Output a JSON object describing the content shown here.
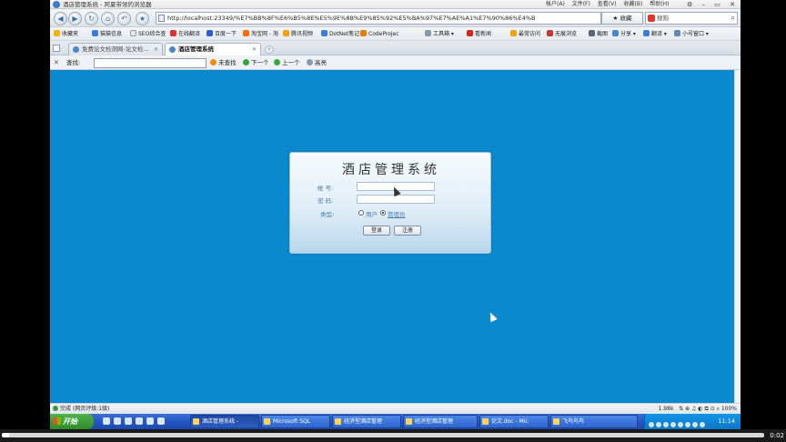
{
  "window": {
    "title": "酒店管理系统 - 阿夏带领的浏览器",
    "menus": [
      "帐户(A)",
      "文件(F)",
      "查看(V)",
      "收藏(B)",
      "帮助(H)"
    ],
    "controls": [
      "⚙",
      "–",
      "▭",
      "✕"
    ]
  },
  "nav": {
    "back_icon": "back-arrow-icon",
    "forward_icon": "forward-arrow-icon",
    "url": "http://localhost:23349/%E7%BB%8F%E6%B5%8E%E5%9E%8B%E9%85%92%E5%BA%97%E7%AE%A1%E7%90%86%E4%B",
    "favorite_label": "★ 收藏",
    "search_placeholder": "搜狗"
  },
  "bookmarks": [
    "收藏夹",
    "猫猫信息",
    "SEO综合查",
    "在线翻译",
    "百度一下",
    "淘宝网 - 淘",
    "腾讯视频",
    "DotNet笔记",
    "CodeProjec",
    "工具箱",
    "看新闻",
    "最常访问",
    "无痕浏览",
    "截图",
    "分享",
    "翻译",
    "小号窗口"
  ],
  "tabs": [
    {
      "label": "免费论文检测网-论文检...",
      "active": false
    },
    {
      "label": "酒店管理系统",
      "active": true
    }
  ],
  "findbar": {
    "label": "查找:",
    "not_found": "未查找",
    "next": "下一个",
    "prev": "上一个",
    "highlight": "高亮"
  },
  "login": {
    "title": "酒店管理系统",
    "account_label": "帐  号:",
    "password_label": "密  码:",
    "type_label": "类型:",
    "type_user": "用户",
    "type_admin": "管理员",
    "selected_type": "管理员",
    "login_button": "登录",
    "register_button": "注册"
  },
  "status": {
    "left": "完成 (网页评级:1级)",
    "zoom": "100%",
    "speed": "1.98k"
  },
  "taskbar": {
    "start": "开始",
    "tasks": [
      {
        "label": "酒店管理系统 -",
        "active": true
      },
      {
        "label": "Microsoft SQL",
        "active": false
      },
      {
        "label": "经济型酒店管理",
        "active": false
      },
      {
        "label": "经济型酒店管理",
        "active": false
      },
      {
        "label": "论文.doc - Mic",
        "active": false
      },
      {
        "label": "飞鸟鸟鸟",
        "active": false
      }
    ],
    "clock": "11:14"
  },
  "player": {
    "time": "0:02",
    "progress": 0.01
  }
}
